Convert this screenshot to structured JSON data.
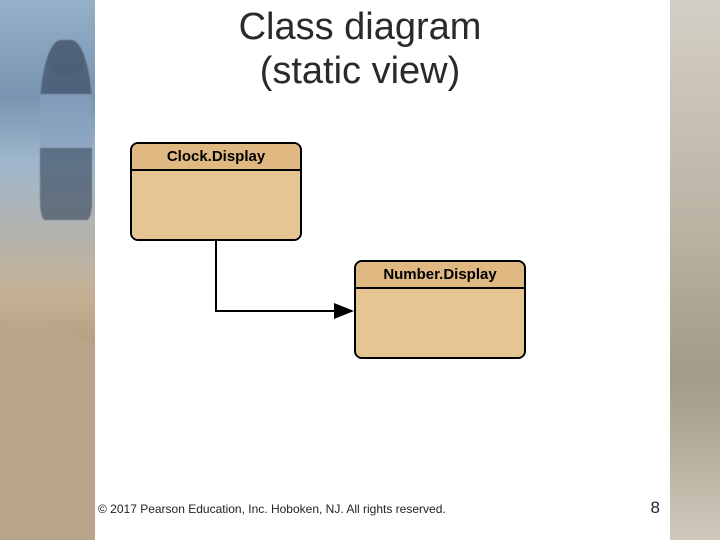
{
  "title_line1": "Class diagram",
  "title_line2": "(static view)",
  "classes": {
    "a": {
      "name": "Clock.Display"
    },
    "b": {
      "name": "Number.Display"
    }
  },
  "footer": "© 2017 Pearson Education, Inc. Hoboken, NJ. All rights reserved.",
  "page_number": "8"
}
